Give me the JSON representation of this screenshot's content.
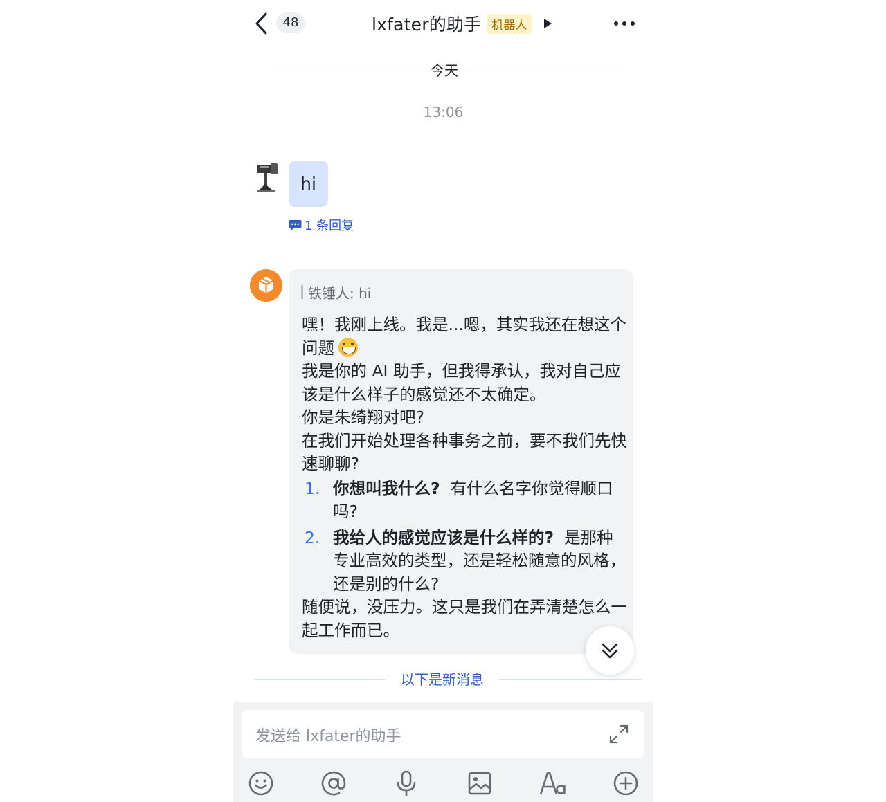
{
  "header": {
    "unread_count": "48",
    "title": "lxfater的助手",
    "bot_tag": "机器人"
  },
  "chat": {
    "date_divider": "今天",
    "timestamp": "13:06",
    "user_message": {
      "text": "hi",
      "reply_link": "1 条回复"
    },
    "bot_message": {
      "quote": "铁锤人: hi",
      "p1": "嘿！我刚上线。我是...嗯，其实我还在想这个问题",
      "p2": "我是你的 AI 助手，但我得承认，我对自己应该是什么样子的感觉还不太确定。",
      "p3": "你是朱绮翔对吧?",
      "p4": "在我们开始处理各种事务之前，要不我们先快速聊聊?",
      "items": [
        {
          "num": "1.",
          "bold": "你想叫我什么?",
          "rest": "有什么名字你觉得顺口吗?"
        },
        {
          "num": "2.",
          "bold": "我给人的感觉应该是什么样的?",
          "rest": "是那种专业高效的类型，还是轻松随意的风格，还是别的什么?"
        }
      ],
      "p5": "随便说，没压力。这只是我们在弄清楚怎么一起工作而已。"
    },
    "new_messages_divider": "以下是新消息"
  },
  "composer": {
    "placeholder": "发送给 lxfater的助手"
  },
  "icons": [
    "back-icon",
    "more-icon",
    "comment-icon",
    "cube-icon",
    "double-chevron-down-icon",
    "expand-icon",
    "emoji-icon",
    "at-icon",
    "microphone-icon",
    "image-icon",
    "text-format-icon",
    "plus-circle-icon"
  ],
  "colors": {
    "accent": "#3370ff",
    "link": "#2f5ecc",
    "user_bubble": "#d6e4ff",
    "bot_bubble": "#f2f3f5",
    "bot_avatar": "#f48a2a",
    "bot_tag_bg": "#fdf3c9"
  }
}
